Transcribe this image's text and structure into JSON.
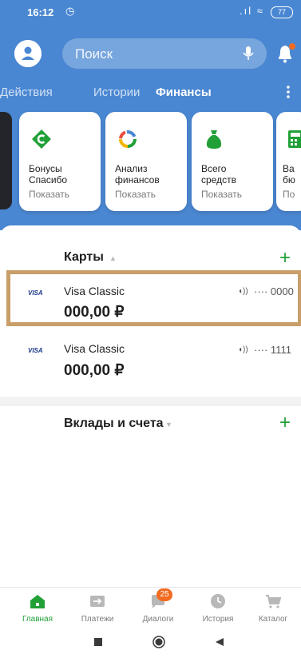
{
  "statusbar": {
    "time": "16:12",
    "battery": "77"
  },
  "header": {
    "search_placeholder": "Поиск"
  },
  "tabs": [
    {
      "label": "Действия"
    },
    {
      "label": "Истории"
    },
    {
      "label": "Финансы"
    }
  ],
  "quick_cards": [
    {
      "title_line1": "Бонусы",
      "title_line2": "Спасибо",
      "action": "Показать",
      "icon": "spasibo-icon"
    },
    {
      "title_line1": "Анализ",
      "title_line2": "финансов",
      "action": "Показать",
      "icon": "analytics-icon"
    },
    {
      "title_line1": "Всего",
      "title_line2": "средств",
      "action": "Показать",
      "icon": "money-bag-icon"
    },
    {
      "title_line1": "Ва",
      "title_line2": "бю",
      "action": "По",
      "icon": "calculator-icon"
    }
  ],
  "cards_section": {
    "title": "Карты",
    "items": [
      {
        "brand": "VISA",
        "name": "Visa Classic",
        "amount": "000,00 ₽",
        "number": "···· 0000"
      },
      {
        "brand": "VISA",
        "name": "Visa Classic",
        "amount": "000,00 ₽",
        "number": "···· 1111"
      }
    ]
  },
  "deposits_section": {
    "title": "Вклады и счета"
  },
  "bottom_nav": [
    {
      "label": "Главная",
      "icon": "home-icon"
    },
    {
      "label": "Платежи",
      "icon": "payments-icon"
    },
    {
      "label": "Диалоги",
      "icon": "dialogs-icon",
      "badge": "25"
    },
    {
      "label": "История",
      "icon": "history-icon"
    },
    {
      "label": "Каталог",
      "icon": "catalog-icon"
    }
  ],
  "colors": {
    "header_blue": "#4a87d2",
    "brand_green": "#21a038",
    "badge_orange": "#f26b21",
    "highlight": "#c89f68"
  }
}
